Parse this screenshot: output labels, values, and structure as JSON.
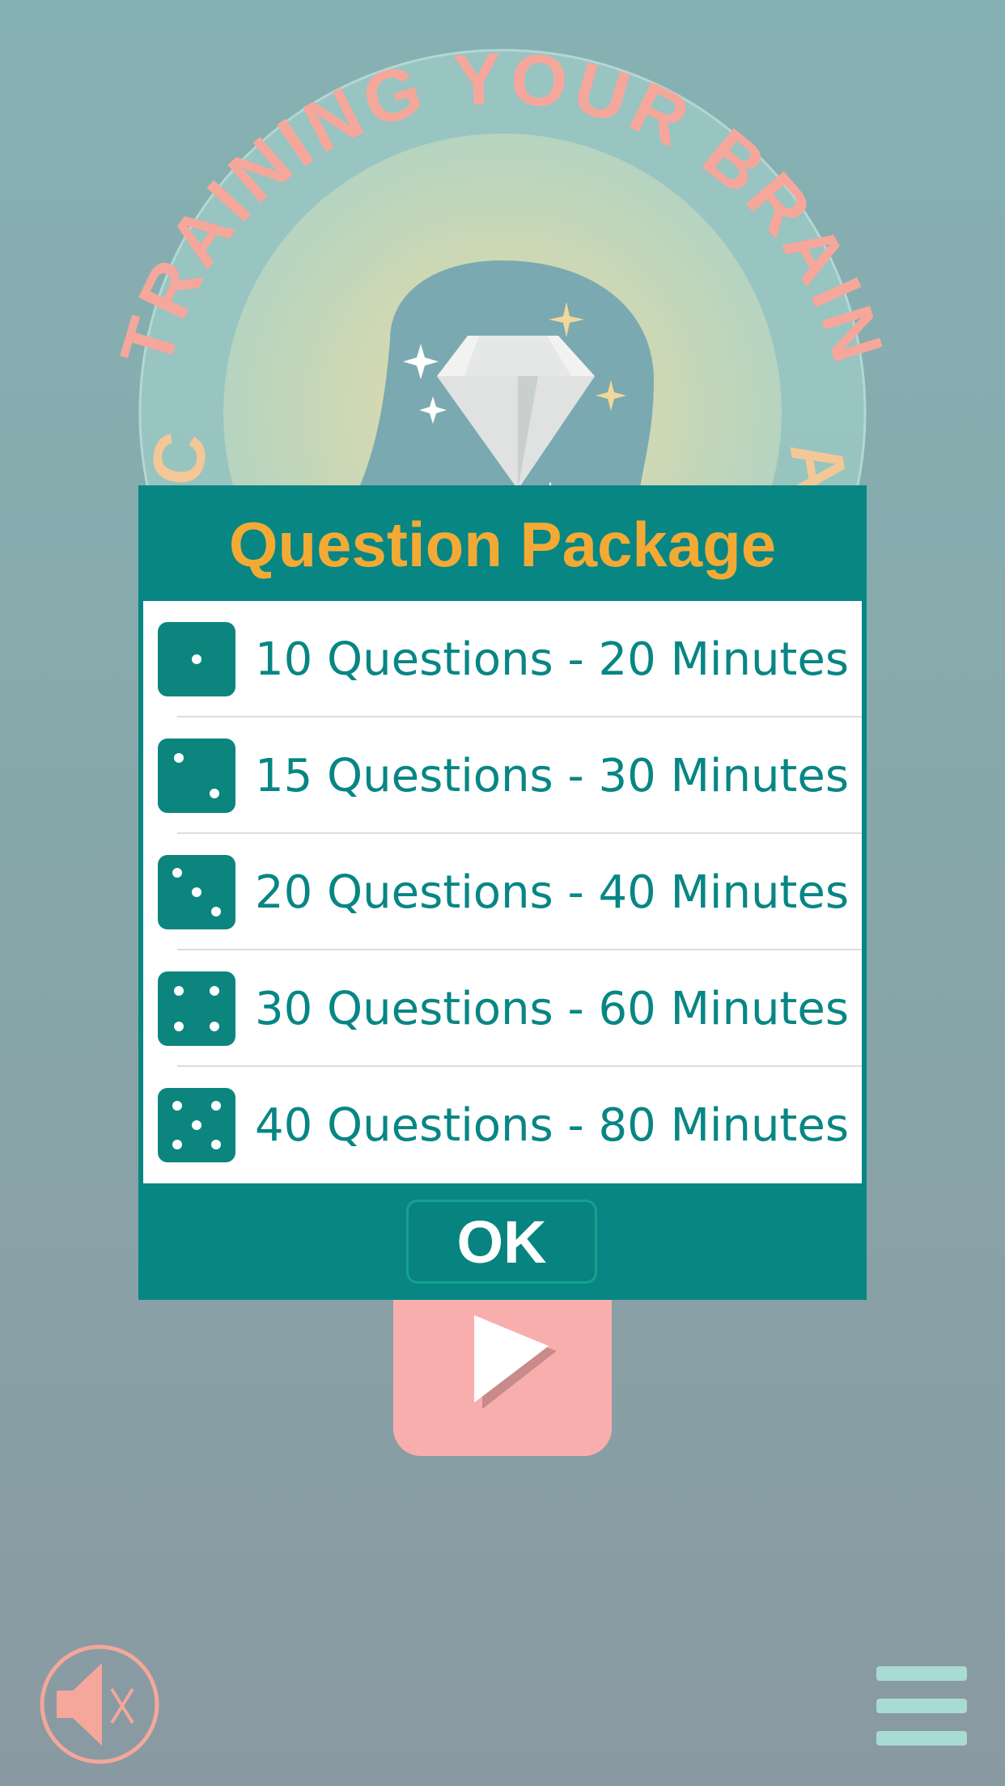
{
  "logo": {
    "arc_text": "TRAINING YOUR BRAIN",
    "left_fragment": "C",
    "right_fragment": "A"
  },
  "dialog": {
    "title": "Question Package",
    "options": [
      {
        "label": "10 Questions - 20 Minutes",
        "icon": "die-one-icon"
      },
      {
        "label": "15 Questions - 30 Minutes",
        "icon": "die-two-icon"
      },
      {
        "label": "20 Questions - 40 Minutes",
        "icon": "die-three-icon"
      },
      {
        "label": "30 Questions - 60 Minutes",
        "icon": "die-four-icon"
      },
      {
        "label": "40 Questions - 80 Minutes",
        "icon": "die-five-icon"
      }
    ],
    "ok_label": "OK"
  },
  "controls": {
    "play_icon": "play-icon",
    "sound_icon": "sound-muted-icon",
    "menu_icon": "hamburger-menu-icon"
  },
  "colors": {
    "dialog_bg": "#078684",
    "title": "#f3aa34",
    "option_text": "#078684",
    "play_button": "#f9aeae",
    "logo_text": "#f6a79b",
    "menu_bars": "#a8dcd3"
  }
}
